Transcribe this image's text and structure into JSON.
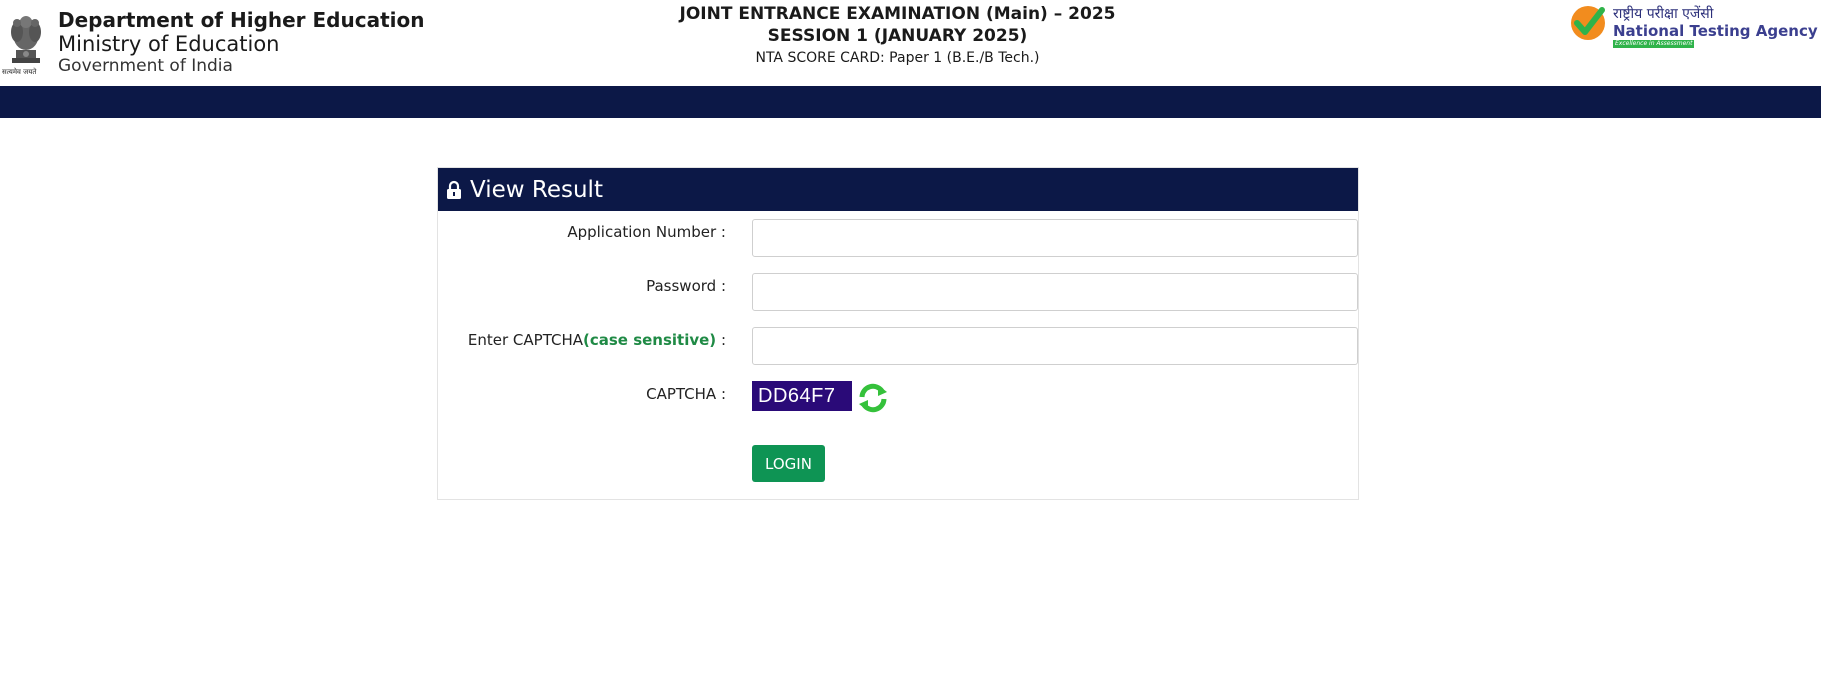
{
  "header": {
    "emblem_motto": "सत्यमेव जयते",
    "dept_title": "Department of Higher Education",
    "dept_ministry": "Ministry of Education",
    "dept_government": "Government of India",
    "exam_title": "JOINT ENTRANCE EXAMINATION (Main) – 2025",
    "exam_session": "SESSION 1 (JANUARY 2025)",
    "exam_scorecard": "NTA SCORE CARD: Paper 1 (B.E./B Tech.)",
    "nta_hindi": "राष्ट्रीय परीक्षा एजेंसी",
    "nta_english": "National Testing Agency",
    "nta_tagline": "Excellence in Assessment"
  },
  "panel": {
    "title": "View Result",
    "application_number_label": "Application Number :",
    "application_number_value": "",
    "password_label": "Password :",
    "password_value": "",
    "captcha_input_label_prefix": "Enter CAPTCHA",
    "captcha_input_label_highlight": "(case sensitive)",
    "captcha_input_label_suffix": " :",
    "captcha_input_value": "",
    "captcha_label": "CAPTCHA :",
    "captcha_text": "DD64F7",
    "login_label": "LOGIN"
  },
  "colors": {
    "navy": "#0c1847",
    "login_green": "#0e9454",
    "captcha_bg": "#2a0a78",
    "case_sensitive_green": "#1f8a45"
  },
  "icons": {
    "lock": "lock-icon",
    "refresh": "refresh-icon",
    "emblem": "national-emblem-icon",
    "nta_logo": "nta-check-icon"
  }
}
